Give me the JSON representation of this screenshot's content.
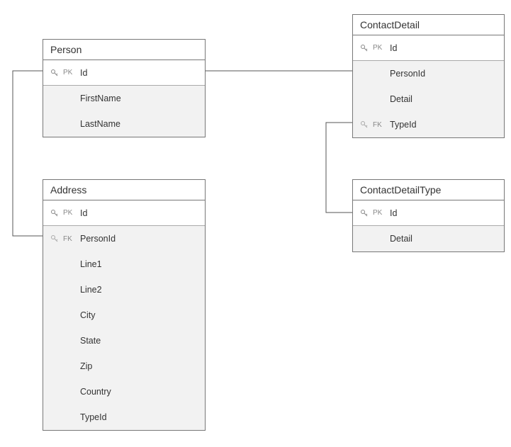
{
  "tables": {
    "person": {
      "title": "Person",
      "pk_label": "PK",
      "columns": {
        "id": "Id",
        "firstName": "FirstName",
        "lastName": "LastName"
      }
    },
    "contactDetail": {
      "title": "ContactDetail",
      "pk_label": "PK",
      "fk_label": "FK",
      "columns": {
        "id": "Id",
        "personId": "PersonId",
        "detail": "Detail",
        "typeId": "TypeId"
      }
    },
    "address": {
      "title": "Address",
      "pk_label": "PK",
      "fk_label": "FK",
      "columns": {
        "id": "Id",
        "personId": "PersonId",
        "line1": "Line1",
        "line2": "Line2",
        "city": "City",
        "state": "State",
        "zip": "Zip",
        "country": "Country",
        "typeId": "TypeId"
      }
    },
    "contactDetailType": {
      "title": "ContactDetailType",
      "pk_label": "PK",
      "columns": {
        "id": "Id",
        "detail": "Detail"
      }
    }
  },
  "chart_data": {
    "type": "er-diagram",
    "entities": [
      {
        "name": "Person",
        "columns": [
          {
            "name": "Id",
            "pk": true
          },
          {
            "name": "FirstName"
          },
          {
            "name": "LastName"
          }
        ]
      },
      {
        "name": "ContactDetail",
        "columns": [
          {
            "name": "Id",
            "pk": true
          },
          {
            "name": "PersonId"
          },
          {
            "name": "Detail"
          },
          {
            "name": "TypeId",
            "fk": true
          }
        ]
      },
      {
        "name": "Address",
        "columns": [
          {
            "name": "Id",
            "pk": true
          },
          {
            "name": "PersonId",
            "fk": true
          },
          {
            "name": "Line1"
          },
          {
            "name": "Line2"
          },
          {
            "name": "City"
          },
          {
            "name": "State"
          },
          {
            "name": "Zip"
          },
          {
            "name": "Country"
          },
          {
            "name": "TypeId"
          }
        ]
      },
      {
        "name": "ContactDetailType",
        "columns": [
          {
            "name": "Id",
            "pk": true
          },
          {
            "name": "Detail"
          }
        ]
      }
    ],
    "relationships": [
      {
        "from": "Person.Id",
        "to": "ContactDetail.PersonId"
      },
      {
        "from": "Person.Id",
        "to": "Address.PersonId"
      },
      {
        "from": "ContactDetailType.Id",
        "to": "ContactDetail.TypeId"
      }
    ]
  }
}
